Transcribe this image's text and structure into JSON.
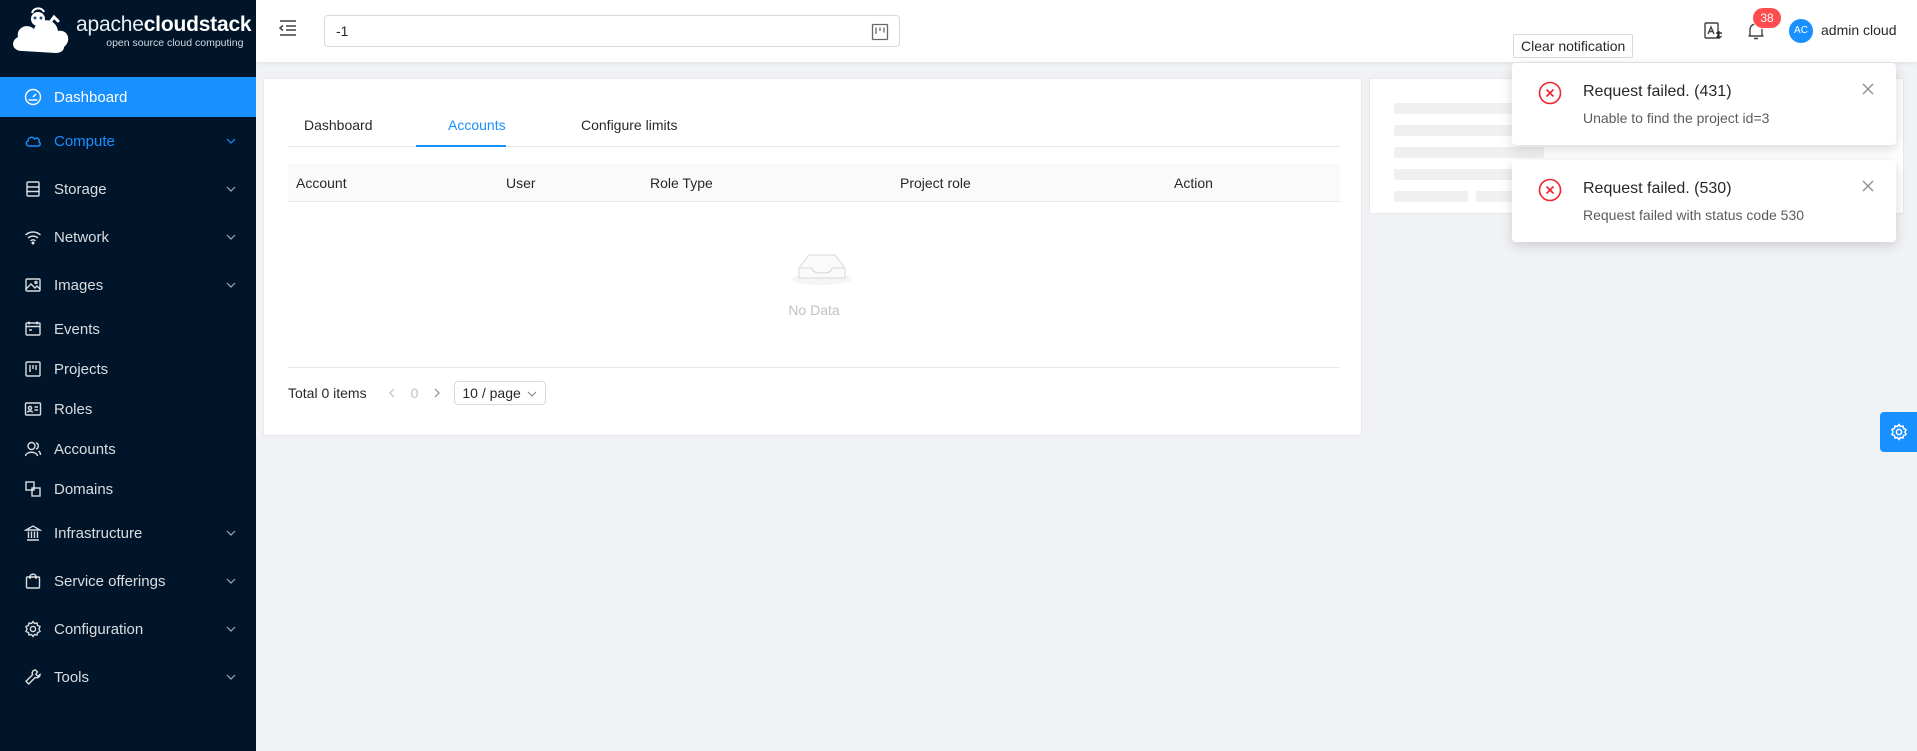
{
  "brand": {
    "name_bold_1": "apache",
    "name_bold_2": "cloudstack",
    "tagline": "open source cloud computing"
  },
  "sidebar": {
    "items": [
      {
        "label": "Dashboard",
        "icon": "dashboard-icon",
        "state": "active"
      },
      {
        "label": "Compute",
        "icon": "cloud-icon",
        "state": "open",
        "submenu": true
      },
      {
        "label": "Storage",
        "icon": "database-icon",
        "submenu": true
      },
      {
        "label": "Network",
        "icon": "wifi-icon",
        "submenu": true
      },
      {
        "label": "Images",
        "icon": "picture-icon",
        "submenu": true
      },
      {
        "label": "Events",
        "icon": "schedule-icon"
      },
      {
        "label": "Projects",
        "icon": "project-icon"
      },
      {
        "label": "Roles",
        "icon": "idcard-icon"
      },
      {
        "label": "Accounts",
        "icon": "team-icon"
      },
      {
        "label": "Domains",
        "icon": "block-icon"
      },
      {
        "label": "Infrastructure",
        "icon": "bank-icon",
        "submenu": true
      },
      {
        "label": "Service offerings",
        "icon": "shopping-icon",
        "submenu": true
      },
      {
        "label": "Configuration",
        "icon": "setting-icon",
        "submenu": true
      },
      {
        "label": "Tools",
        "icon": "tool-icon",
        "submenu": true
      }
    ]
  },
  "header": {
    "search_value": "-1",
    "notification_count": "38",
    "avatar_initials": "AC",
    "username": "admin cloud"
  },
  "main": {
    "tabs": [
      {
        "label": "Dashboard"
      },
      {
        "label": "Accounts",
        "active": true
      },
      {
        "label": "Configure limits"
      }
    ],
    "table": {
      "columns": [
        "Account",
        "User",
        "Role Type",
        "Project role",
        "Action"
      ],
      "empty_text": "No Data"
    },
    "pagination": {
      "total_text": "Total 0 items",
      "current_page": "0",
      "page_size": "10 / page"
    }
  },
  "notifications": {
    "clear_label": "Clear notification",
    "items": [
      {
        "title": "Request failed. (431)",
        "description": "Unable to find the project id=3"
      },
      {
        "title": "Request failed. (530)",
        "description": "Request failed with status code 530"
      }
    ]
  },
  "colors": {
    "sidebar_bg": "#001529",
    "primary": "#1890ff",
    "error": "#f5222d",
    "badge": "#ff4d4f"
  }
}
